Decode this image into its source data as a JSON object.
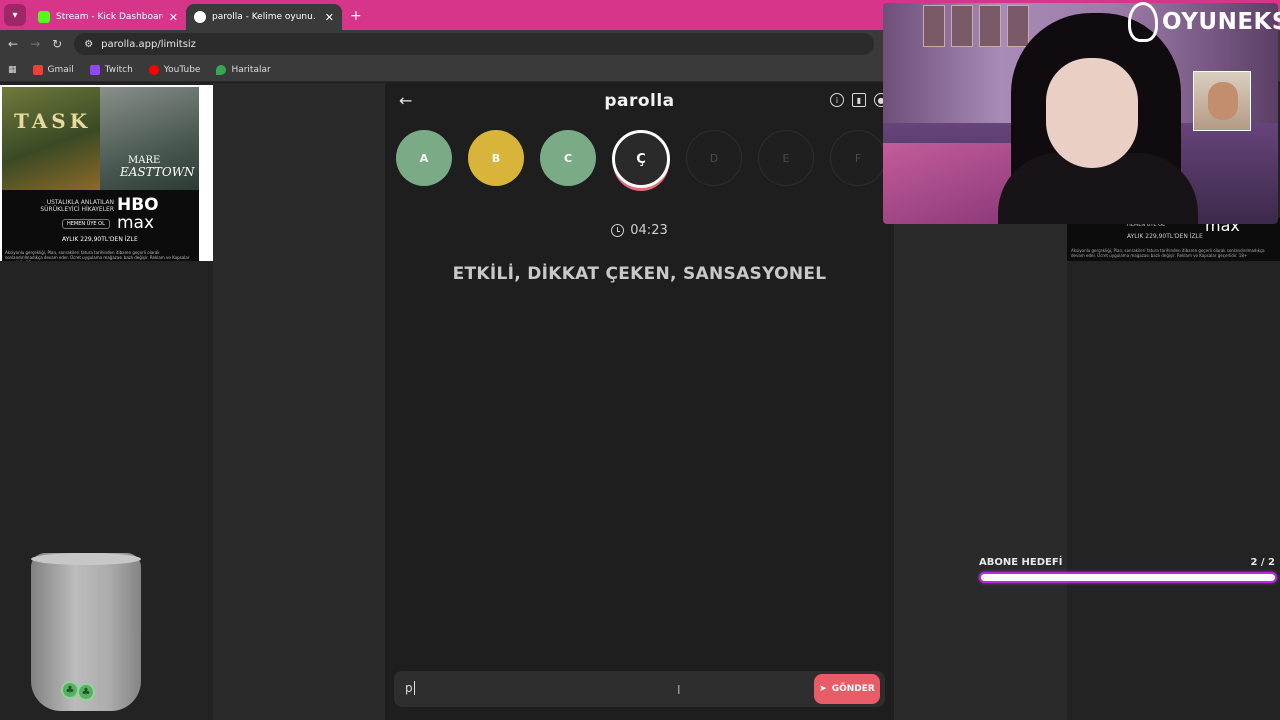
{
  "browser": {
    "tabs": [
      {
        "title": "Stream - Kick Dashboard",
        "favicon_color": "#53fc18"
      },
      {
        "title": "parolla - Kelime oyunu. Günlük",
        "favicon_color": "#ffffff"
      }
    ],
    "url": "parolla.app/limitsiz",
    "bookmarks": [
      {
        "label": "Gmail",
        "color": "#ea4335"
      },
      {
        "label": "Twitch",
        "color": "#9146ff"
      },
      {
        "label": "YouTube",
        "color": "#ff0000"
      },
      {
        "label": "Haritalar",
        "color": "#34a853"
      }
    ]
  },
  "ad_left": {
    "show1": "TASK",
    "show2_line1": "MARE",
    "show2_line2": "EASTTOWN",
    "tagline": "USTALIKLA ANLATILAN SÜRÜKLEYİCİ HİKAYELER",
    "brand1": "HBO",
    "brand2": "max",
    "cta": "HEMEN ÜYE OL",
    "price": "AYLIK 229,90TL'DEN İZLE",
    "legal": "Aksiyonlu gerçekliği, Plan, sonrakileri fatura tarihinden itibaren geçerli olarak sonlandırılmadıkça devam eder. Ücret uygulama mağazası bazlı değişir. Reklam ve Kapsalar geçerlidir. 18+"
  },
  "ad_right": {
    "cta": "HEMEN ÜYE OL",
    "brand": "max",
    "price": "AYLIK 229,90TL'DEN İZLE",
    "legal": "Aksiyonlu gerçekliği, Plan, sonrakileri fatura tarihinden itibaren geçerli olarak sonlandırılmadıkça devam eder. Ücret uygulama mağazası bazlı değişir. Reklam ve Kapsalar geçerlidir. 18+"
  },
  "game": {
    "logo": "parolla",
    "letters": [
      {
        "label": "A",
        "state": "correct"
      },
      {
        "label": "B",
        "state": "passed"
      },
      {
        "label": "C",
        "state": "correct"
      },
      {
        "label": "Ç",
        "state": "current"
      },
      {
        "label": "D",
        "state": "pending"
      },
      {
        "label": "E",
        "state": "pending"
      },
      {
        "label": "F",
        "state": "pending"
      }
    ],
    "colors": {
      "correct": "#7bab86",
      "passed": "#d9b43a",
      "accent": "#e85c68"
    },
    "timer": "04:23",
    "clue": "ETKİLİ, DİKKAT ÇEKEN, SANSASYONEL",
    "input_value": "p",
    "send_label": "GÖNDER"
  },
  "stream_overlay": {
    "brand": "OYUNEKS",
    "goal_label": "ABONE HEDEFİ",
    "goal_value": "2 / 2",
    "goal_progress": 1.0
  }
}
